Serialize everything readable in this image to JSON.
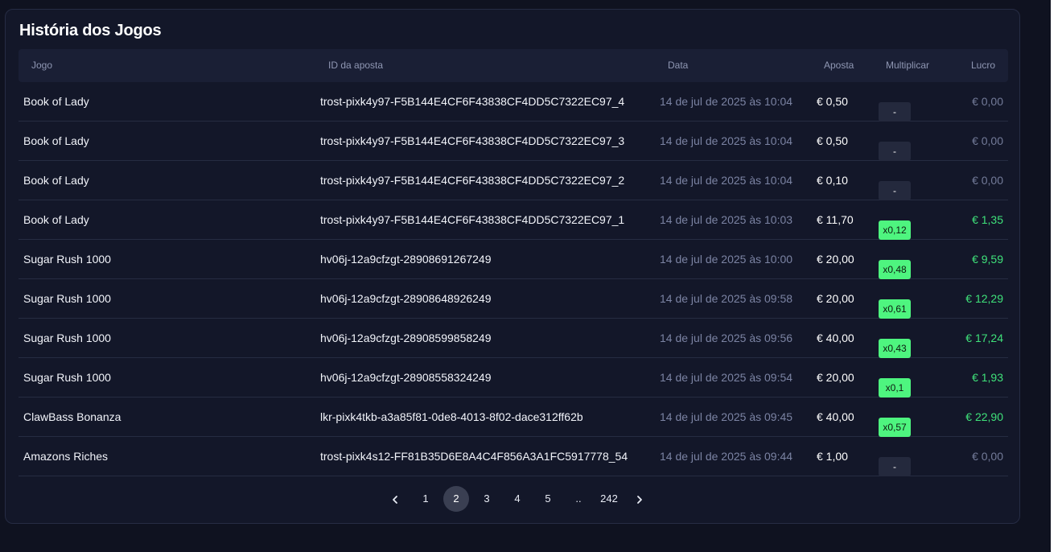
{
  "panel": {
    "title": "História dos Jogos"
  },
  "table": {
    "headers": {
      "game": "Jogo",
      "bet_id": "ID da aposta",
      "date": "Data",
      "bet": "Aposta",
      "multiplier": "Multiplicar",
      "profit": "Lucro"
    },
    "rows": [
      {
        "game": "Book of Lady",
        "bet_id": "trost-pixk4y97-F5B144E4CF6F43838CF4DD5C7322EC97_4",
        "date": "14 de jul de 2025 às 10:04",
        "bet": "€ 0,50",
        "multiplier": "-",
        "profit": "€ 0,00",
        "win": false
      },
      {
        "game": "Book of Lady",
        "bet_id": "trost-pixk4y97-F5B144E4CF6F43838CF4DD5C7322EC97_3",
        "date": "14 de jul de 2025 às 10:04",
        "bet": "€ 0,50",
        "multiplier": "-",
        "profit": "€ 0,00",
        "win": false
      },
      {
        "game": "Book of Lady",
        "bet_id": "trost-pixk4y97-F5B144E4CF6F43838CF4DD5C7322EC97_2",
        "date": "14 de jul de 2025 às 10:04",
        "bet": "€ 0,10",
        "multiplier": "-",
        "profit": "€ 0,00",
        "win": false
      },
      {
        "game": "Book of Lady",
        "bet_id": "trost-pixk4y97-F5B144E4CF6F43838CF4DD5C7322EC97_1",
        "date": "14 de jul de 2025 às 10:03",
        "bet": "€ 11,70",
        "multiplier": "x0,12",
        "profit": "€ 1,35",
        "win": true
      },
      {
        "game": "Sugar Rush 1000",
        "bet_id": "hv06j-12a9cfzgt-28908691267249",
        "date": "14 de jul de 2025 às 10:00",
        "bet": "€ 20,00",
        "multiplier": "x0,48",
        "profit": "€ 9,59",
        "win": true
      },
      {
        "game": "Sugar Rush 1000",
        "bet_id": "hv06j-12a9cfzgt-28908648926249",
        "date": "14 de jul de 2025 às 09:58",
        "bet": "€ 20,00",
        "multiplier": "x0,61",
        "profit": "€ 12,29",
        "win": true
      },
      {
        "game": "Sugar Rush 1000",
        "bet_id": "hv06j-12a9cfzgt-28908599858249",
        "date": "14 de jul de 2025 às 09:56",
        "bet": "€ 40,00",
        "multiplier": "x0,43",
        "profit": "€ 17,24",
        "win": true
      },
      {
        "game": "Sugar Rush 1000",
        "bet_id": "hv06j-12a9cfzgt-28908558324249",
        "date": "14 de jul de 2025 às 09:54",
        "bet": "€ 20,00",
        "multiplier": "x0,1",
        "profit": "€ 1,93",
        "win": true
      },
      {
        "game": "ClawBass Bonanza",
        "bet_id": "lkr-pixk4tkb-a3a85f81-0de8-4013-8f02-dace312ff62b",
        "date": "14 de jul de 2025 às 09:45",
        "bet": "€ 40,00",
        "multiplier": "x0,57",
        "profit": "€ 22,90",
        "win": true
      },
      {
        "game": "Amazons Riches",
        "bet_id": "trost-pixk4s12-FF81B35D6E8A4C4F856A3A1FC5917778_54",
        "date": "14 de jul de 2025 às 09:44",
        "bet": "€ 1,00",
        "multiplier": "-",
        "profit": "€ 0,00",
        "win": false
      }
    ]
  },
  "pagination": {
    "prev_icon": "chevron-left-icon",
    "next_icon": "chevron-right-icon",
    "pages": [
      "1",
      "2",
      "3",
      "4",
      "5",
      "..",
      "242"
    ],
    "current": "2"
  },
  "colors": {
    "background": "#0f1220",
    "panel": "#131729",
    "win_badge": "#4ef57f",
    "win_text": "#3fe27a",
    "muted_text": "#737b99"
  }
}
